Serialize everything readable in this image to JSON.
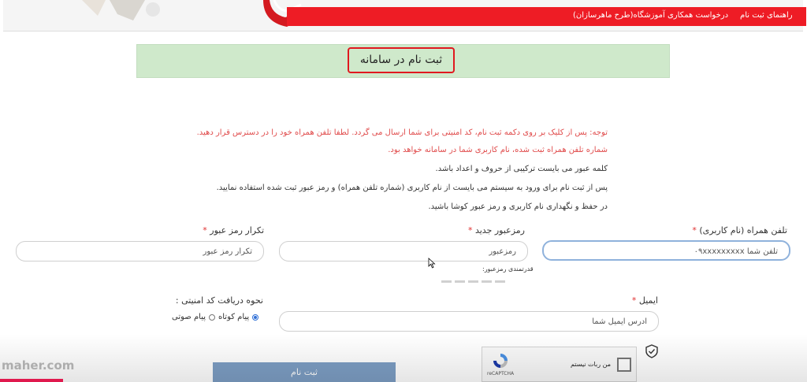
{
  "header": {
    "nav_items": [
      "راهنمای ثبت نام",
      "درخواست همکاری آموزشگاه(طرح ماهرسازان)"
    ],
    "accent_color": "#ee1c25"
  },
  "title": "ثبت نام در سامانه",
  "notes": [
    "توجه: پس از کلیک بر روی دکمه ثبت نام، کد امنیتی برای شما ارسال می گردد. لطفا تلفن همراه خود را در دسترس قرار دهید.",
    "شماره تلفن همراه ثبت شده، نام کاربری شما در سامانه خواهد بود.",
    "کلمه عبور می بایست ترکیبی از حروف و اعداد باشد.",
    "پس از ثبت نام برای ورود به سیستم می بایست از نام کاربری (شماره تلفن همراه) و رمز عبور ثبت شده استفاده نمایید.",
    "در حفظ و نگهداری نام کاربری و رمز عبور کوشا باشید."
  ],
  "form": {
    "phone": {
      "label": "تلفن همراه (نام کاربری)",
      "required_mark": "*",
      "placeholder": "تلفن شما ۰۹xxxxxxxxx"
    },
    "password": {
      "label": "رمزعبور جدید",
      "required_mark": "*",
      "placeholder": "رمزعبور",
      "strength_label": "قدرتمندی رمزعبور:"
    },
    "confirm": {
      "label": "تکرار رمز عبور",
      "required_mark": "*",
      "placeholder": "تکرار رمز عبور"
    },
    "email": {
      "label": "ایمیل",
      "required_mark": "*",
      "placeholder": "آدرس ایمیل شما"
    },
    "code_method": {
      "label": "نحوه دریافت کد امنیتی :",
      "options": [
        "پیام کوتاه",
        "پیام صوتی"
      ],
      "selected": "پیام کوتاه"
    }
  },
  "captcha": {
    "label": "من ربات نیستم",
    "brand": "reCAPTCHA"
  },
  "submit_label": "ثبت نام",
  "watermark": "maher.com"
}
